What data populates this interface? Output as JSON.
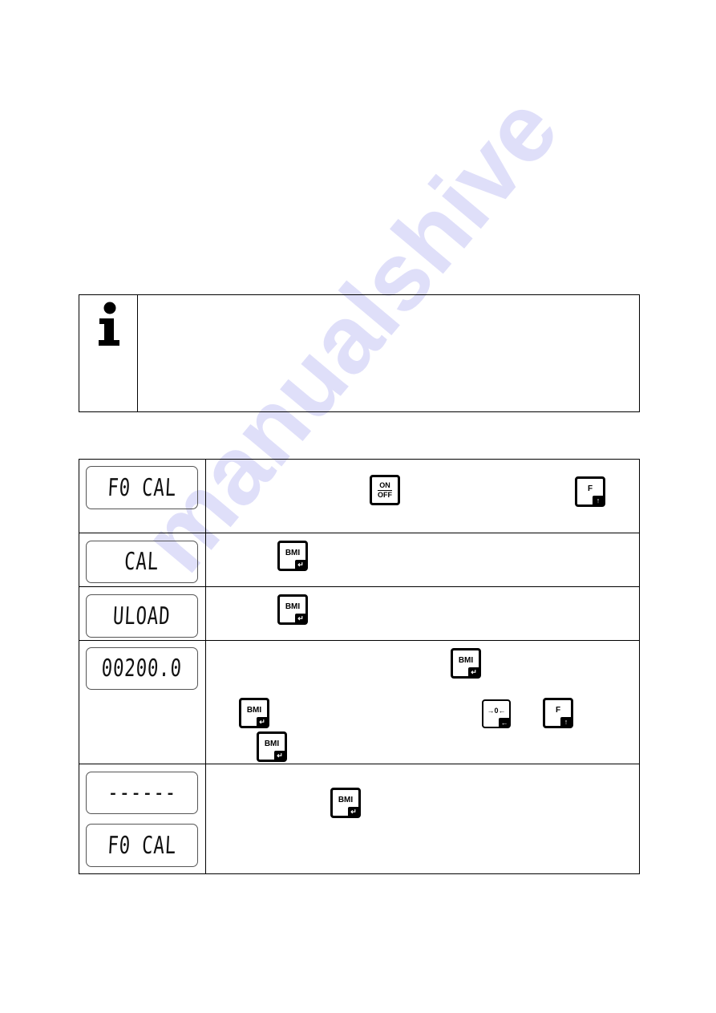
{
  "watermark": "manualshive",
  "info_box": {
    "icon": "info-icon"
  },
  "steps": [
    {
      "displays": [
        "F0 CAL"
      ],
      "keys": [
        {
          "top": "ON",
          "bottom": "OFF",
          "icon": "on-off-key"
        },
        {
          "label": "F",
          "corner": "↑",
          "icon": "f-up-key"
        }
      ]
    },
    {
      "displays": [
        "CAL"
      ],
      "keys": [
        {
          "label": "BMI",
          "corner": "↵",
          "icon": "bmi-enter-key"
        }
      ]
    },
    {
      "displays": [
        "ULOAD"
      ],
      "keys": [
        {
          "label": "BMI",
          "corner": "↵",
          "icon": "bmi-enter-key"
        }
      ]
    },
    {
      "displays": [
        "00200.0"
      ],
      "keys": [
        {
          "label": "BMI",
          "corner": "↵",
          "icon": "bmi-enter-key"
        },
        {
          "label": "BMI",
          "corner": "↵",
          "icon": "bmi-enter-key"
        },
        {
          "label": "→0←",
          "corner": "←",
          "icon": "zero-left-key"
        },
        {
          "label": "F",
          "corner": "↑",
          "icon": "f-up-key"
        },
        {
          "label": "BMI",
          "corner": "↵",
          "icon": "bmi-enter-key"
        }
      ]
    },
    {
      "displays": [
        "------",
        "F0 CAL"
      ],
      "keys": [
        {
          "label": "BMI",
          "corner": "↵",
          "icon": "bmi-enter-key"
        }
      ]
    }
  ]
}
